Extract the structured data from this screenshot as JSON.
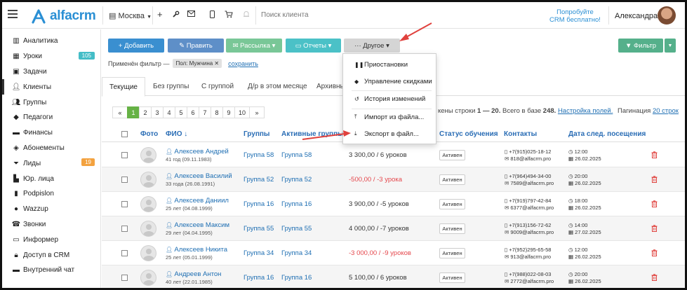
{
  "topbar": {
    "logo_text": "alfacrm",
    "branch": "Москва",
    "search_placeholder": "Поиск клиента",
    "promo_line1": "Попробуйте",
    "promo_line2": "CRM бесплатно!",
    "user_name": "Александра"
  },
  "sidebar": {
    "items": [
      {
        "label": "Аналитика",
        "icon": "analytics-icon"
      },
      {
        "label": "Уроки",
        "icon": "calendar-icon",
        "badge": "105"
      },
      {
        "label": "Задачи",
        "icon": "tasks-icon"
      },
      {
        "label": "Клиенты",
        "icon": "user-icon"
      },
      {
        "label": "Группы",
        "icon": "users-icon"
      },
      {
        "label": "Педагоги",
        "icon": "graduation-cap-icon"
      },
      {
        "label": "Финансы",
        "icon": "money-icon"
      },
      {
        "label": "Абонементы",
        "icon": "tag-icon"
      },
      {
        "label": "Лиды",
        "icon": "funnel-icon",
        "badge": "19"
      },
      {
        "label": "Юр. лица",
        "icon": "building-icon"
      },
      {
        "label": "Podpislon",
        "icon": "document-icon"
      },
      {
        "label": "Wazzup",
        "icon": "whatsapp-icon"
      },
      {
        "label": "Звонки",
        "icon": "phone-icon"
      },
      {
        "label": "Информер",
        "icon": "chat-icon"
      },
      {
        "label": "Доступ в CRM",
        "icon": "lock-icon"
      },
      {
        "label": "Внутренний чат",
        "icon": "message-icon"
      }
    ]
  },
  "toolbar": {
    "add": "+ Добавить",
    "edit": "✎ Править",
    "mailing": "✉ Рассылка ▾",
    "reports": "▭ Отчеты ▾",
    "other": "··· Другое ▾",
    "filter": "▼ Фильтр"
  },
  "filter_info": {
    "label": "Применён фильтр —",
    "chip": "Пол: Мужчина ✕",
    "save": "сохранить"
  },
  "tabs": [
    "Текущие",
    "Без группы",
    "С группой",
    "Д/р в этом месяце",
    "Архивные"
  ],
  "pager": [
    "«",
    "1",
    "2",
    "3",
    "4",
    "5",
    "6",
    "7",
    "8",
    "9",
    "10",
    "»"
  ],
  "rows_info": {
    "text1": "кены строки",
    "range_start": "1",
    "dash": "—",
    "range_end": "20.",
    "total_label": "Всего в базе",
    "total": "248.",
    "fields_link": "Настройка полей.",
    "pagination_label": "Пагинация",
    "pagination_link": "20 строк"
  },
  "table": {
    "headers": {
      "photo": "Фото",
      "name": "ФИО ↓",
      "groups": "Группы",
      "active_groups": "Активные группы",
      "status": "Статус обучения",
      "contacts": "Контакты",
      "next_visit": "Дата след. посещения"
    },
    "rows": [
      {
        "name": "Алексеев Андрей",
        "age": "41 год (09.11.1983)",
        "group": "Группа 58",
        "active_group": "Группа 58",
        "balance": "3 300,00 / 6 уроков",
        "negative": false,
        "status": "Активен",
        "phone": "+7(915)025-18-12",
        "email": "818@alfacrm.pro",
        "time": "12:00",
        "date": "26.02.2025"
      },
      {
        "name": "Алексеев Василий",
        "age": "33 года (26.08.1991)",
        "group": "Группа 52",
        "active_group": "Группа 52",
        "balance": "-500,00 / -3 урока",
        "negative": true,
        "status": "Активен",
        "phone": "+7(964)494-34-00",
        "email": "7589@alfacrm.pro",
        "time": "20:00",
        "date": "26.02.2025"
      },
      {
        "name": "Алексеев Даниил",
        "age": "25 лет (04.08.1999)",
        "group": "Группа 16",
        "active_group": "Группа 16",
        "balance": "3 900,00 / -5 уроков",
        "negative": false,
        "status": "Активен",
        "phone": "+7(919)797-42-84",
        "email": "6377@alfacrm.pro",
        "time": "18:00",
        "date": "26.02.2025"
      },
      {
        "name": "Алексеев Максим",
        "age": "29 лет (04.04.1995)",
        "group": "Группа 55",
        "active_group": "Группа 55",
        "balance": "4 000,00 / -7 уроков",
        "negative": false,
        "status": "Активен",
        "phone": "+7(913)156-72-62",
        "email": "9009@alfacrm.pro",
        "time": "14:00",
        "date": "27.02.2025"
      },
      {
        "name": "Алексеев Никита",
        "age": "25 лет (05.01.1999)",
        "group": "Группа 34",
        "active_group": "Группа 34",
        "balance": "-3 000,00 / -9 уроков",
        "negative": true,
        "status": "Активен",
        "phone": "+7(952)295-65-58",
        "email": "913@alfacrm.pro",
        "time": "12:00",
        "date": "26.02.2025"
      },
      {
        "name": "Андреев Антон",
        "age": "40 лет (22.01.1985)",
        "group": "Группа 16",
        "active_group": "Группа 16",
        "balance": "5 100,00 / 6 уроков",
        "negative": false,
        "status": "Активен",
        "phone": "+7(988)022-08-03",
        "email": "2772@alfacrm.pro",
        "time": "20:00",
        "date": "26.02.2025"
      }
    ]
  },
  "dropdown": {
    "items": [
      {
        "label": "Приостановки",
        "icon": "pause-icon"
      },
      {
        "label": "Управление скидками",
        "icon": "discount-tag-icon"
      },
      {
        "label": "История изменений",
        "icon": "history-icon"
      },
      {
        "label": "Импорт из файла...",
        "icon": "upload-icon"
      },
      {
        "label": "Экспорт в файл...",
        "icon": "download-icon"
      }
    ]
  },
  "colors": {
    "primary": "#3a8fd0",
    "edit": "#5e8fc8",
    "mailing": "#79c797",
    "reports": "#4bc1c7",
    "other": "#d5d5d5",
    "filter": "#55b08b",
    "accent_red": "#e0413d",
    "link": "#1f6fb3"
  }
}
